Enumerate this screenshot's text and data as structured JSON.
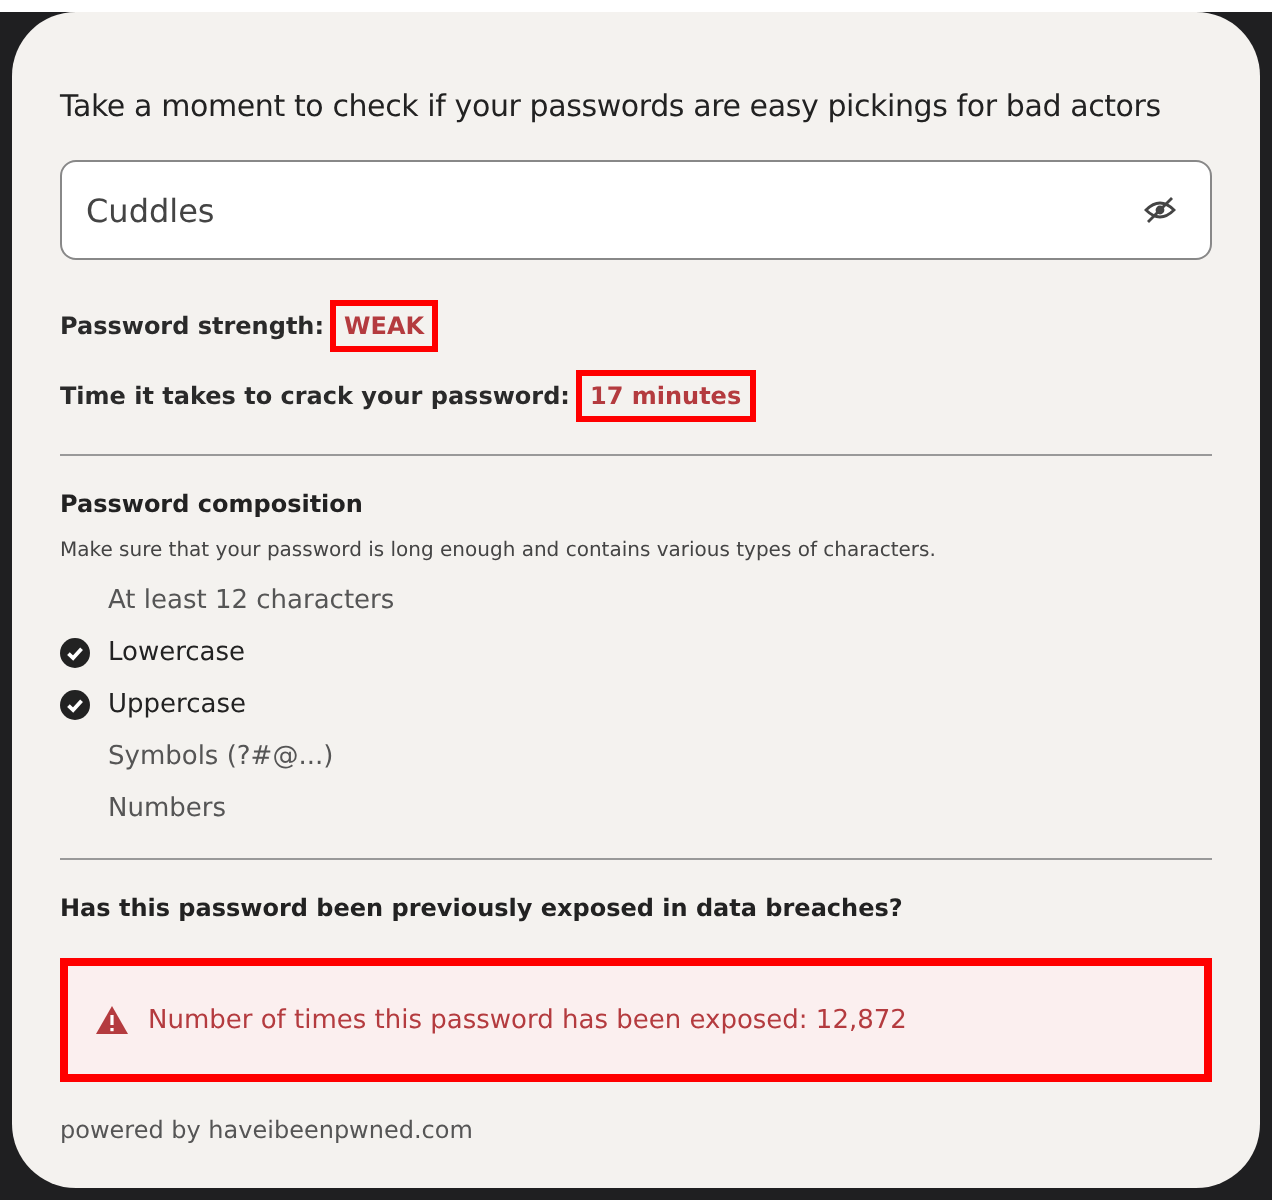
{
  "title": "Take a moment to check if your passwords are easy pickings for bad actors",
  "password_field": {
    "value": "Cuddles"
  },
  "strength": {
    "label": "Password strength:",
    "value": "WEAK",
    "highlighted": true
  },
  "crack_time": {
    "label": "Time it takes to crack your password:",
    "value": "17 minutes",
    "highlighted": true
  },
  "composition": {
    "heading": "Password composition",
    "hint": "Make sure that your password is long enough and contains various types of characters.",
    "items": [
      {
        "label": "At least 12 characters",
        "checked": false
      },
      {
        "label": "Lowercase",
        "checked": true
      },
      {
        "label": "Uppercase",
        "checked": true
      },
      {
        "label": "Symbols (?#@...)",
        "checked": false
      },
      {
        "label": "Numbers",
        "checked": false
      }
    ]
  },
  "breach": {
    "question": "Has this password been previously exposed in data breaches?",
    "alert": "Number of times this password has been exposed: 12,872",
    "highlighted": true
  },
  "footer": "powered by haveibeenpwned.com"
}
